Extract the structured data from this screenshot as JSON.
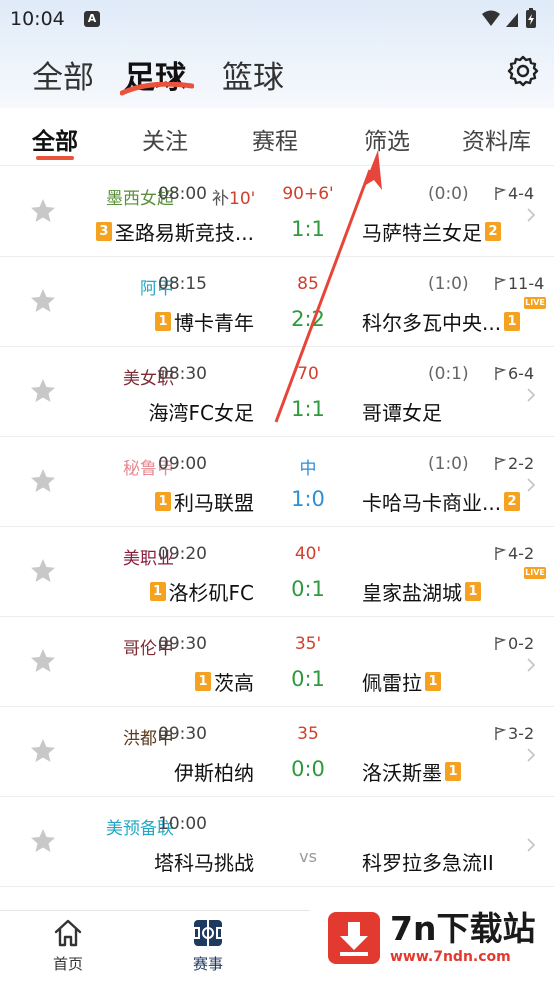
{
  "status_bar": {
    "time": "10:04",
    "notification": "A"
  },
  "sport_tabs": [
    {
      "label": "全部"
    },
    {
      "label": "足球"
    },
    {
      "label": "篮球"
    }
  ],
  "sub_tabs": [
    {
      "label": "全部"
    },
    {
      "label": "关注"
    },
    {
      "label": "赛程"
    },
    {
      "label": "筛选"
    },
    {
      "label": "资料库"
    }
  ],
  "matches": [
    {
      "league": "墨西女超",
      "league_color": "#5a8f3c",
      "time": "08:00",
      "extra_1": "补",
      "extra_2": "10'",
      "status": "90+6'",
      "status_color": "#d0402e",
      "half": "(0:0)",
      "corner": "4-4",
      "home_rank": "3",
      "home": "圣路易斯竞技...",
      "score": "1:1",
      "score_color": "#2e9a3d",
      "away": "马萨特兰女足",
      "away_rank": "2",
      "live": ""
    },
    {
      "league": "阿甲",
      "league_color": "#23a7c4",
      "time": "08:15",
      "extra_1": "",
      "extra_2": "",
      "status": "85",
      "status_color": "#d0402e",
      "half": "(1:0)",
      "corner": "11-4",
      "home_rank": "1",
      "home": "博卡青年",
      "score": "2:2",
      "score_color": "#2e9a3d",
      "away": "科尔多瓦中央...",
      "away_rank": "1",
      "live": "LIVE"
    },
    {
      "league": "美女职",
      "league_color": "#7d2b34",
      "time": "08:30",
      "extra_1": "",
      "extra_2": "",
      "status": "70",
      "status_color": "#d0402e",
      "half": "(0:1)",
      "corner": "6-4",
      "home_rank": "",
      "home": "海湾FC女足",
      "score": "1:1",
      "score_color": "#2e9a3d",
      "away": "哥谭女足",
      "away_rank": "",
      "live": ""
    },
    {
      "league": "秘鲁甲",
      "league_color": "#e88a93",
      "time": "09:00",
      "extra_1": "",
      "extra_2": "",
      "status": "中",
      "status_color": "#2d8fd8",
      "half": "(1:0)",
      "corner": "2-2",
      "home_rank": "1",
      "home": "利马联盟",
      "score": "1:0",
      "score_color": "#2d8fd8",
      "away": "卡哈马卡商业...",
      "away_rank": "2",
      "live": ""
    },
    {
      "league": "美职业",
      "league_color": "#8a1f3c",
      "time": "09:20",
      "extra_1": "",
      "extra_2": "",
      "status": "40'",
      "status_color": "#d0402e",
      "half": "",
      "corner": "4-2",
      "home_rank": "1",
      "home": "洛杉矶FC",
      "score": "0:1",
      "score_color": "#2e9a3d",
      "away": "皇家盐湖城",
      "away_rank": "1",
      "live": "LIVE"
    },
    {
      "league": "哥伦甲",
      "league_color": "#7d2b34",
      "time": "09:30",
      "extra_1": "",
      "extra_2": "",
      "status": "35'",
      "status_color": "#d0402e",
      "half": "",
      "corner": "0-2",
      "home_rank": "1",
      "home": "茨高",
      "score": "0:1",
      "score_color": "#2e9a3d",
      "away": "佩雷拉",
      "away_rank": "1",
      "live": ""
    },
    {
      "league": "洪都甲",
      "league_color": "#5b3a1e",
      "time": "09:30",
      "extra_1": "",
      "extra_2": "",
      "status": "35",
      "status_color": "#d0402e",
      "half": "",
      "corner": "3-2",
      "home_rank": "",
      "home": "伊斯柏纳",
      "score": "0:0",
      "score_color": "#2e9a3d",
      "away": "洛沃斯墨",
      "away_rank": "1",
      "live": ""
    },
    {
      "league": "美预备联",
      "league_color": "#23a7c4",
      "time": "10:00",
      "extra_1": "",
      "extra_2": "",
      "status": "",
      "status_color": "#999999",
      "half": "",
      "corner": "",
      "home_rank": "",
      "home": "塔科马挑战",
      "score": "vs",
      "score_color": "#999999",
      "away": "科罗拉多急流II",
      "away_rank": "",
      "live": ""
    }
  ],
  "bottom_nav": [
    {
      "label": "首页",
      "icon": "home-icon"
    },
    {
      "label": "赛事",
      "icon": "match-icon"
    }
  ],
  "watermark": {
    "main": "7n下载站",
    "sub": "www.7ndn.com"
  },
  "colors": {
    "accent": "#e8533a",
    "live": "#f4a21f",
    "rank": "#f4a21f",
    "nav_active": "#1f3a5f"
  }
}
